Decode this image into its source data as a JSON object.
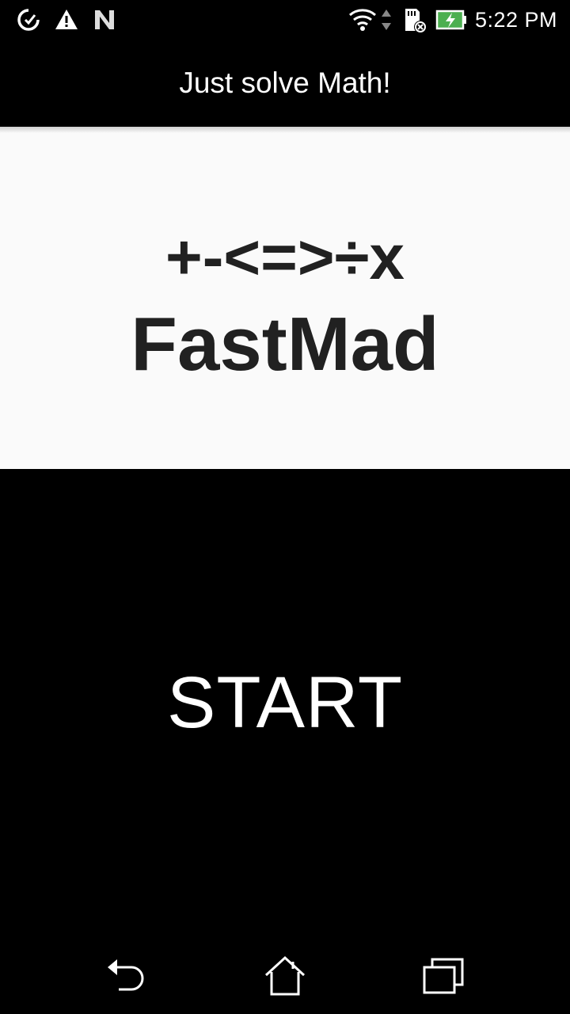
{
  "status_bar": {
    "time": "5:22 PM",
    "left_icons": [
      "data-saver-icon",
      "warning-icon",
      "n-notification-icon"
    ],
    "right_icons": [
      "wifi-icon",
      "data-arrows-icon",
      "sd-card-icon",
      "battery-charging-icon"
    ],
    "battery_color": "#4caf50"
  },
  "toolbar": {
    "title": "Just solve Math!"
  },
  "content": {
    "symbols": "+-<=>÷x",
    "app_name": "FastMad",
    "background": "#fafafa",
    "text_color": "#212121"
  },
  "start_button": {
    "label": "START",
    "background": "#000000",
    "text_color": "#ffffff"
  },
  "nav_bar": {
    "buttons": [
      "back-icon",
      "home-icon",
      "recents-icon"
    ]
  }
}
